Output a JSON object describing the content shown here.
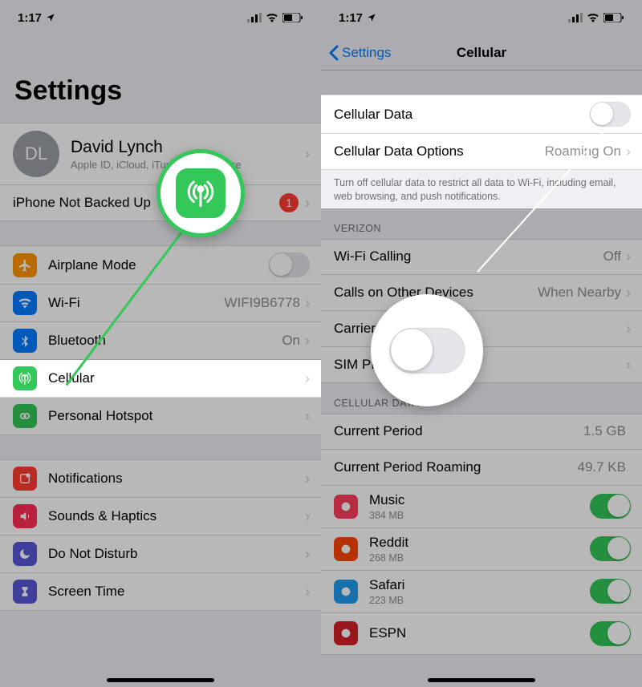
{
  "left": {
    "status_time": "1:17",
    "title": "Settings",
    "profile": {
      "initials": "DL",
      "name": "David Lynch",
      "sub": "Apple ID, iCloud, iTunes & App Store"
    },
    "backup_row": {
      "label": "iPhone Not Backed Up",
      "badge": "1"
    },
    "rows": {
      "airplane": "Airplane Mode",
      "wifi": "Wi-Fi",
      "wifi_detail": "WIFI9B6778",
      "bluetooth": "Bluetooth",
      "bluetooth_detail": "On",
      "cellular": "Cellular",
      "hotspot": "Personal Hotspot",
      "notifications": "Notifications",
      "sounds": "Sounds & Haptics",
      "dnd": "Do Not Disturb",
      "screentime": "Screen Time"
    }
  },
  "right": {
    "status_time": "1:17",
    "back": "Settings",
    "title": "Cellular",
    "rows": {
      "cell_data": "Cellular Data",
      "cell_data_options": {
        "label": "Cellular Data Options",
        "detail": "Roaming On"
      },
      "footer1": "Turn off cellular data to restrict all data to Wi-Fi, including email, web browsing, and push notifications.",
      "header_carrier": "VERIZON",
      "wifi_calling": {
        "label": "Wi-Fi Calling",
        "detail": "Off"
      },
      "calls_other": {
        "label": "Calls on Other Devices",
        "detail": "When Nearby"
      },
      "carrier": "Carrier Services",
      "sim": "SIM PIN",
      "header_usage": "CELLULAR DATA",
      "period": {
        "label": "Current Period",
        "detail": "1.5 GB"
      },
      "period_roam": {
        "label": "Current Period Roaming",
        "detail": "49.7 KB"
      },
      "apps": [
        {
          "name": "Music",
          "usage": "384 MB",
          "color": "#fc3d5b"
        },
        {
          "name": "Reddit",
          "usage": "268 MB",
          "color": "#ff4500"
        },
        {
          "name": "Safari",
          "usage": "223 MB",
          "color": "#1f9cf0"
        },
        {
          "name": "ESPN",
          "usage": "",
          "color": "#d4222a"
        }
      ]
    }
  }
}
